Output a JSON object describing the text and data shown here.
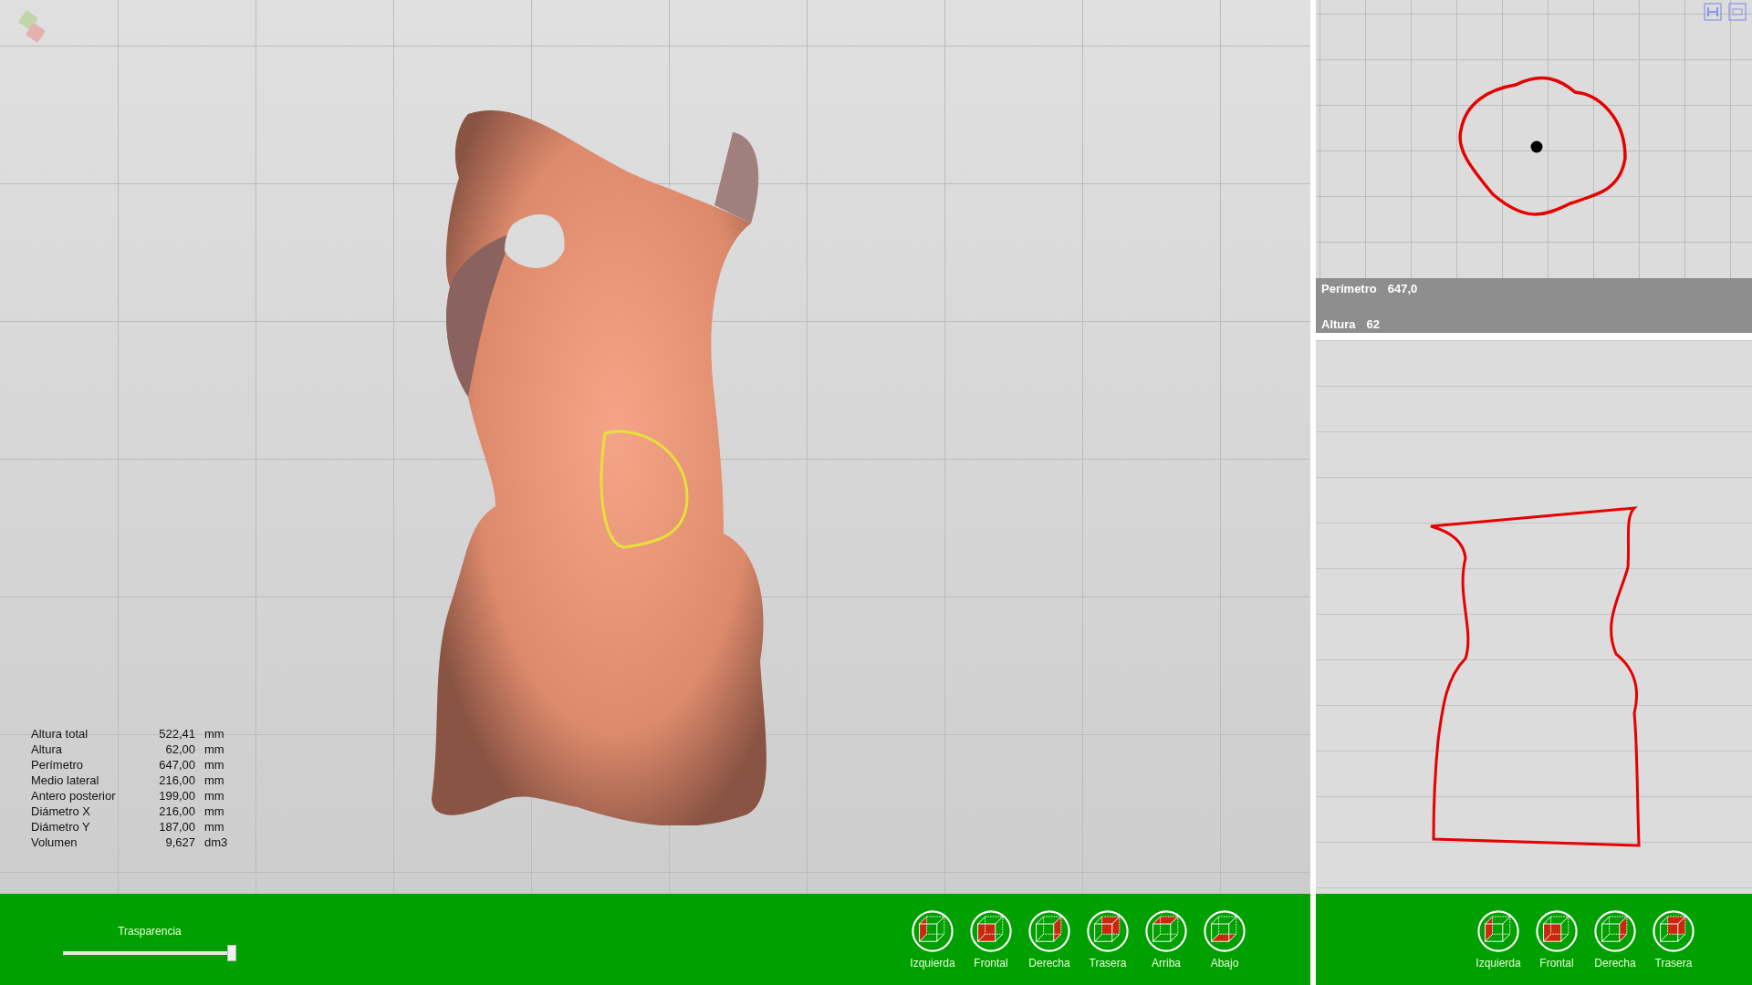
{
  "measurements": [
    {
      "label": "Altura total",
      "value": "522,41",
      "unit": "mm"
    },
    {
      "label": "Altura",
      "value": "62,00",
      "unit": "mm"
    },
    {
      "label": "Perímetro",
      "value": "647,00",
      "unit": "mm"
    },
    {
      "label": "Medio lateral",
      "value": "216,00",
      "unit": "mm"
    },
    {
      "label": "Antero posterior",
      "value": "199,00",
      "unit": "mm"
    },
    {
      "label": "Diámetro  X",
      "value": "216,00",
      "unit": "mm"
    },
    {
      "label": "Diámetro  Y",
      "value": "187,00",
      "unit": "mm"
    },
    {
      "label": "Volumen",
      "value": "9,627",
      "unit": "dm3"
    }
  ],
  "transparency": {
    "label": "Trasparencia",
    "level": 1
  },
  "view_buttons": [
    {
      "label": "Izquierda",
      "kind": "left"
    },
    {
      "label": "Frontal",
      "kind": "front"
    },
    {
      "label": "Derecha",
      "kind": "right"
    },
    {
      "label": "Trasera",
      "kind": "back"
    },
    {
      "label": "Arriba",
      "kind": "top"
    },
    {
      "label": "Abajo",
      "kind": "bottom"
    }
  ],
  "section_info": [
    {
      "label": "Perímetro",
      "value": "647,0"
    },
    {
      "label": "Altura",
      "value": "62"
    }
  ],
  "side_view_buttons": [
    {
      "label": "Izquierda",
      "kind": "left"
    },
    {
      "label": "Frontal",
      "kind": "front"
    },
    {
      "label": "Derecha",
      "kind": "right"
    },
    {
      "label": "Trasera",
      "kind": "back"
    }
  ]
}
